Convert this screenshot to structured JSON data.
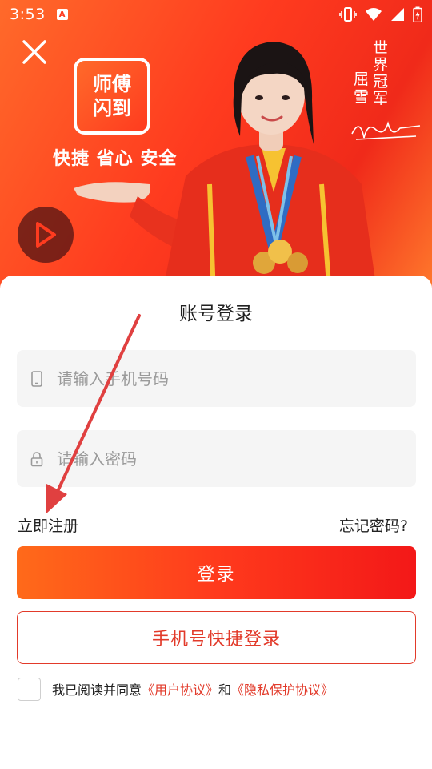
{
  "status_bar": {
    "time": "3:53",
    "app_badge": "A"
  },
  "hero": {
    "logo_line1": "师傅",
    "logo_line2": "闪到",
    "slogan": "快捷 省心 安全",
    "champion_title": "世界冠军",
    "champion_name": "屈雪"
  },
  "form": {
    "title": "账号登录",
    "phone_placeholder": "请输入手机号码",
    "password_placeholder": "请输入密码",
    "register_link": "立即注册",
    "forgot_link": "忘记密码?",
    "login_button": "登录",
    "quick_login_button": "手机号快捷登录",
    "agree_prefix": "我已阅读并同意",
    "user_agreement": "《用户协议》",
    "agree_and": "和",
    "privacy_agreement": "《隐私保护协议》"
  },
  "colors": {
    "brand_orange": "#ff6a1a",
    "brand_red": "#f31818",
    "link_red": "#e23a2a",
    "annotation_arrow": "#e04040"
  },
  "icons": [
    "close-icon",
    "play-icon",
    "phone-icon",
    "lock-icon",
    "vibrate-icon",
    "wifi-icon",
    "signal-icon",
    "battery-icon"
  ]
}
